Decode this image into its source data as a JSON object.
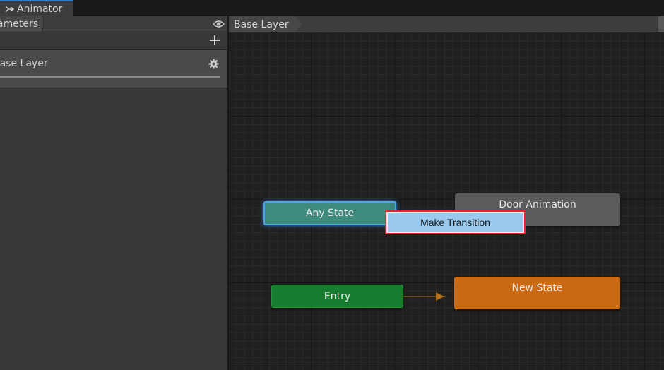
{
  "window": {
    "tab_title": "Animator",
    "tab_icon": "animator-icon"
  },
  "left_panel": {
    "tab_label": "Parameters",
    "visibility_icon": "eye-icon",
    "add_icon": "plus-icon",
    "layer": {
      "name": "Base Layer",
      "settings_icon": "gear-icon"
    }
  },
  "graph": {
    "breadcrumb": "Base Layer",
    "states": {
      "any_state": "Any State",
      "door_animation": "Door Animation",
      "entry": "Entry",
      "new_state": "New State"
    },
    "context_menu": {
      "make_transition": "Make Transition"
    }
  },
  "colors": {
    "any_state": "#3e8a7c",
    "entry": "#167d2e",
    "default_state": "#c96913",
    "state": "#5b5b5b",
    "menu_highlight": "#99c9ef",
    "callout": "#e8232f"
  }
}
